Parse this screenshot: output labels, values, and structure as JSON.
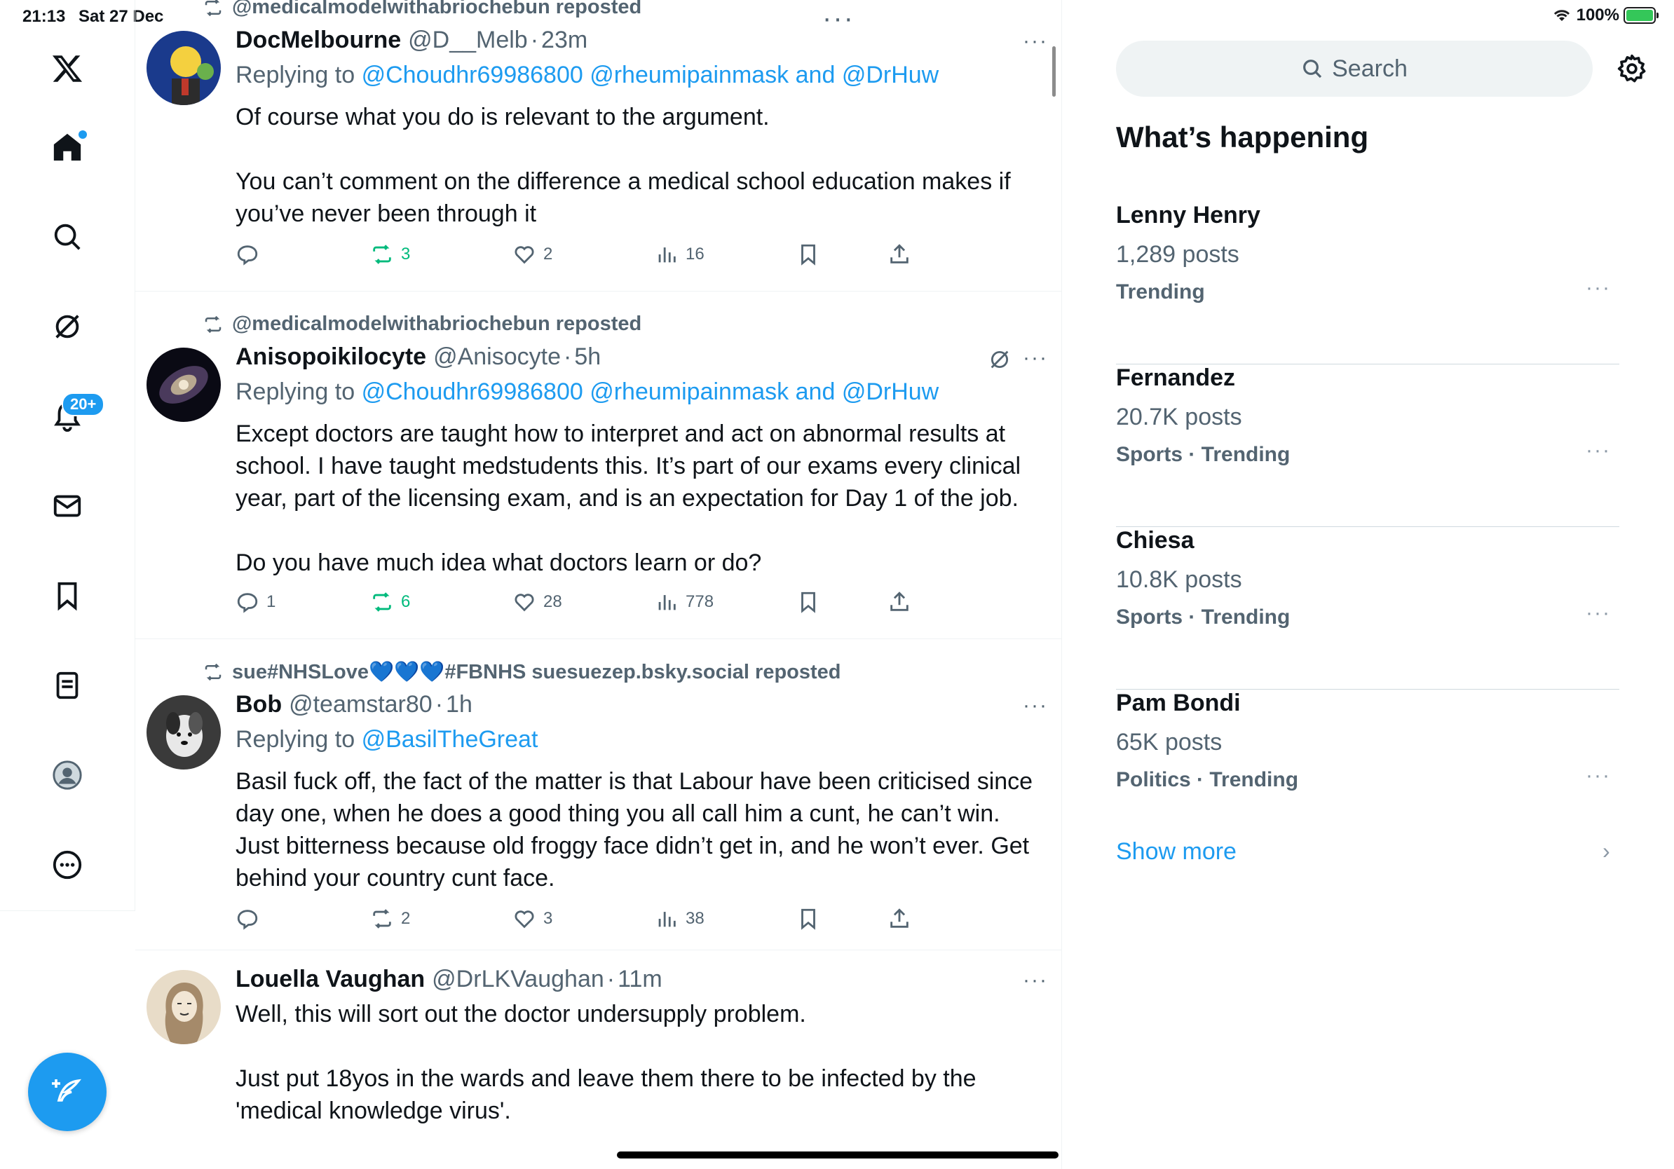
{
  "status_bar": {
    "time": "21:13",
    "date": "Sat 27 Dec",
    "battery": "100%",
    "battery_level": 1.0
  },
  "sidebar": {
    "items": [
      {
        "name": "x-logo-icon"
      },
      {
        "name": "home-icon"
      },
      {
        "name": "explore-search-icon"
      },
      {
        "name": "grok-icon"
      },
      {
        "name": "notifications-icon",
        "badge": "20+"
      },
      {
        "name": "messages-icon"
      },
      {
        "name": "bookmarks-icon"
      },
      {
        "name": "lists-icon"
      },
      {
        "name": "profile-icon"
      },
      {
        "name": "more-icon"
      }
    ],
    "compose_icon": "feather-plus-icon"
  },
  "timeline": {
    "top_repost": "@medicalmodelwithabriochebun reposted",
    "tweets": [
      {
        "name": "DocMelbourne",
        "handle": "@D__Melb",
        "time": "23m",
        "reply_prefix": "Replying to",
        "reply_mentions": "@Choudhr69986800 @rheumipainmask",
        "reply_and": "and",
        "reply_last": "@DrHuw",
        "body": [
          "Of course what you do is relevant to the argument.",
          "You can’t comment on the difference a medical school education makes if you’ve never been through it"
        ],
        "replies": "",
        "reposts": "3",
        "likes": "2",
        "views": "16",
        "reposted": true
      },
      {
        "repost_by": "@medicalmodelwithabriochebun reposted",
        "name": "Anisopoikilocyte",
        "handle": "@Anisocyte",
        "time": "5h",
        "reply_prefix": "Replying to",
        "reply_mentions": "@Choudhr69986800 @rheumipainmask",
        "reply_and": "and",
        "reply_last": "@DrHuw",
        "body": [
          "Except doctors are taught how to interpret and act on abnormal results at school. I have taught medstudents this. It’s part of our exams every clinical year, part of the licensing exam, and is an expectation for Day 1 of the job.",
          "Do you have much idea what doctors learn or do?"
        ],
        "replies": "1",
        "reposts": "6",
        "likes": "28",
        "views": "778",
        "reposted": true
      },
      {
        "repost_by_pre": "sue#NHSLove",
        "repost_by_hearts": "💙💙💙",
        "repost_by_post": "#FBNHS suesuezep.bsky.social reposted",
        "name": "Bob",
        "handle": "@teamstar80",
        "time": "1h",
        "reply_prefix": "Replying to",
        "reply_mentions": "@BasilTheGreat",
        "body": [
          "Basil fuck off, the fact of the matter is that Labour have been criticised since day one, when he does a good thing you all call him a cunt, he can’t win. Just bitterness because old froggy face didn’t get in, and he won’t ever. Get behind your country cunt face."
        ],
        "replies": "",
        "reposts": "2",
        "likes": "3",
        "views": "38",
        "reposted": false
      },
      {
        "name": "Louella Vaughan",
        "handle": "@DrLKVaughan",
        "time": "11m",
        "body": [
          "Well, this will sort out the doctor undersupply problem.",
          "Just put 18yos in the wards and leave them there to be infected by the 'medical knowledge virus'."
        ]
      }
    ]
  },
  "right_panel": {
    "search_placeholder": "Search",
    "section_title": "What’s happening",
    "trends": [
      {
        "name": "Lenny Henry",
        "count": "1,289 posts",
        "meta": "Trending"
      },
      {
        "name": "Fernandez",
        "count": "20.7K posts",
        "meta": "Sports · Trending"
      },
      {
        "name": "Chiesa",
        "count": "10.8K posts",
        "meta": "Sports · Trending"
      },
      {
        "name": "Pam Bondi",
        "count": "65K posts",
        "meta": "Politics · Trending"
      }
    ],
    "show_more": "Show more",
    "more_glyph": "···"
  },
  "colors": {
    "accent": "#1d9bf0",
    "repost_green": "#00ba7c",
    "secondary_text": "#536471"
  }
}
